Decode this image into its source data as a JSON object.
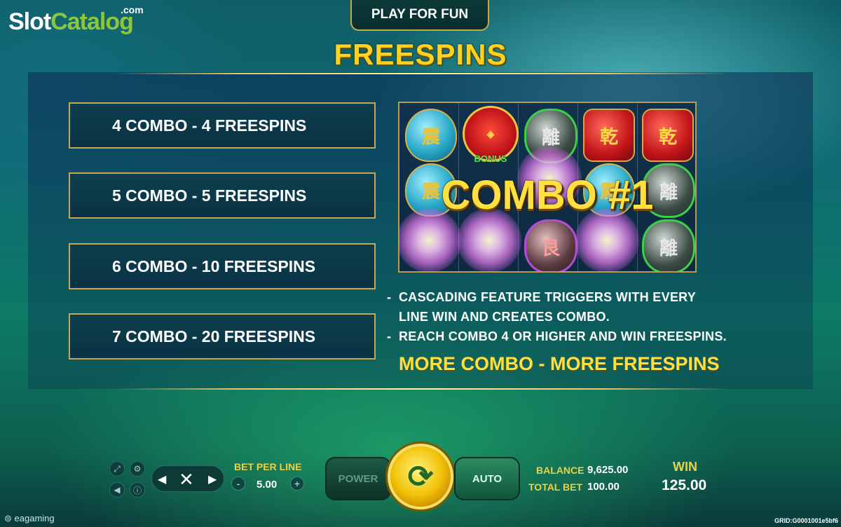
{
  "watermark": {
    "part1": "Slot",
    "part2": "Catalog",
    "suffix": ".com"
  },
  "header": {
    "play_for_fun_label": "PLAY FOR FUN",
    "title": "FREESPINS"
  },
  "combo_table": [
    {
      "label": "4 COMBO - 4 FREESPINS"
    },
    {
      "label": "5 COMBO - 5 FREESPINS"
    },
    {
      "label": "6 COMBO - 10 FREESPINS"
    },
    {
      "label": "7 COMBO - 20 FREESPINS"
    }
  ],
  "reel_preview": {
    "combo_text": "COMBO #1",
    "bonus_text": "BONUS",
    "symbols": {
      "teal": "震",
      "red": "乾",
      "green": "離",
      "darkred": "艮"
    }
  },
  "description": {
    "lines": [
      "CASCADING FEATURE TRIGGERS WITH EVERY",
      "LINE WIN AND CREATES COMBO.",
      "REACH COMBO 4 OR HIGHER AND WIN FREESPINS."
    ],
    "dash": "-",
    "tagline": "MORE COMBO - MORE FREESPINS"
  },
  "controls": {
    "bet_per_line_label": "BET PER LINE",
    "bet_per_line_value": "5.00",
    "minus": "-",
    "plus": "+",
    "power_label": "POWER",
    "auto_label": "AUTO",
    "balance_label": "BALANCE",
    "balance_value": "9,625.00",
    "total_bet_label": "TOTAL BET",
    "total_bet_value": "100.00",
    "win_label": "WIN",
    "win_value": "125.00"
  },
  "footer": {
    "brand": "eagaming",
    "grid_id": "GRID:G0001001e5bf6"
  },
  "icons": [
    "fullscreen-icon",
    "settings-icon",
    "sound-icon",
    "info-icon",
    "arrow-left-icon",
    "close-icon",
    "arrow-right-icon",
    "spin-icon"
  ],
  "colors": {
    "accent_gold": "#ffd21f",
    "frame_gold": "#c7a656",
    "text": "#ffffff"
  }
}
